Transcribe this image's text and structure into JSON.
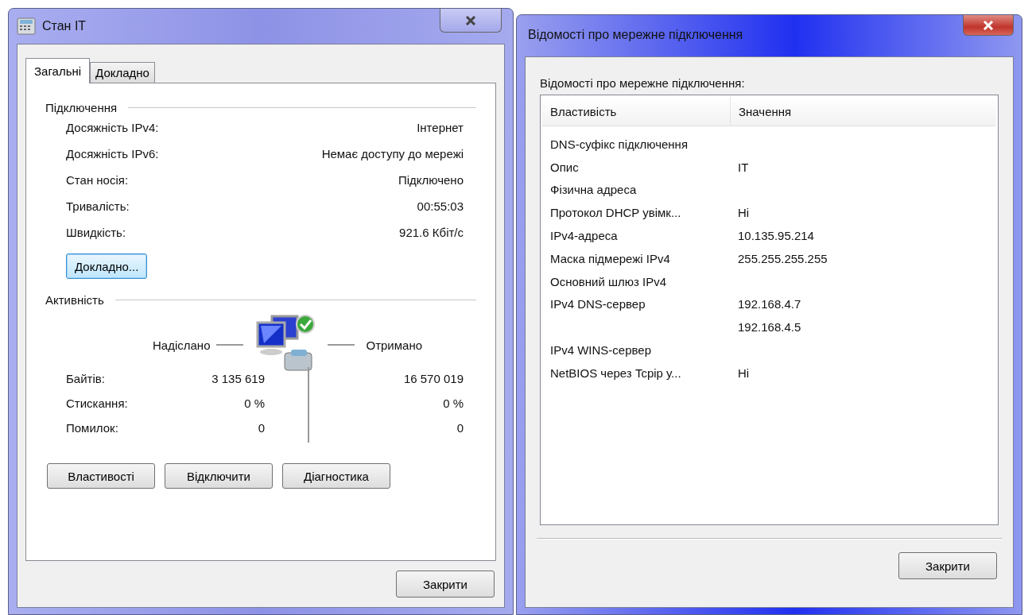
{
  "status_dialog": {
    "title": "Стан IT",
    "tabs": [
      {
        "label": "Загальні",
        "selected": true
      },
      {
        "label": "Докладно",
        "selected": false
      }
    ],
    "connection": {
      "heading": "Підключення",
      "rows": [
        {
          "label": "Досяжність IPv4:",
          "value": "Інтернет"
        },
        {
          "label": "Досяжність IPv6:",
          "value": "Немає доступу до мережі"
        },
        {
          "label": "Стан носія:",
          "value": "Підключено"
        },
        {
          "label": "Тривалість:",
          "value": "00:55:03"
        },
        {
          "label": "Швидкість:",
          "value": "921.6 Кбіт/с"
        }
      ]
    },
    "details_button": "Докладно...",
    "activity": {
      "heading": "Активність",
      "sent_label": "Надіслано",
      "received_label": "Отримано",
      "rows": [
        {
          "label": "Байтів:",
          "sent": "3 135 619",
          "received": "16 570 019"
        },
        {
          "label": "Стискання:",
          "sent": "0 %",
          "received": "0 %"
        },
        {
          "label": "Помилок:",
          "sent": "0",
          "received": "0"
        }
      ]
    },
    "buttons": [
      "Властивості",
      "Відключити",
      "Діагностика"
    ],
    "close_button": "Закрити"
  },
  "details_dialog": {
    "title": "Відомості про мережне підключення",
    "caption": "Відомості про мережне підключення:",
    "columns": [
      "Властивість",
      "Значення"
    ],
    "rows": [
      {
        "property": "DNS-суфікс підключення"
      },
      {
        "property": "Опис",
        "value": "IT"
      },
      {
        "property": "Фізична адреса"
      },
      {
        "property": "Протокол DHCP увімк...",
        "value": "Ні"
      },
      {
        "property": "IPv4-адреса",
        "value": "10.135.95.214"
      },
      {
        "property": "Маска підмережі IPv4",
        "value": "255.255.255.255"
      },
      {
        "property": "Основний шлюз IPv4"
      },
      {
        "property": "IPv4 DNS-сервер",
        "value": "192.168.4.7"
      },
      {
        "value": "192.168.4.5"
      },
      {
        "property": "IPv4 WINS-сервер"
      },
      {
        "property": "NetBIOS через Tcpip у...",
        "value": "Ні"
      }
    ],
    "close_button": "Закрити"
  }
}
